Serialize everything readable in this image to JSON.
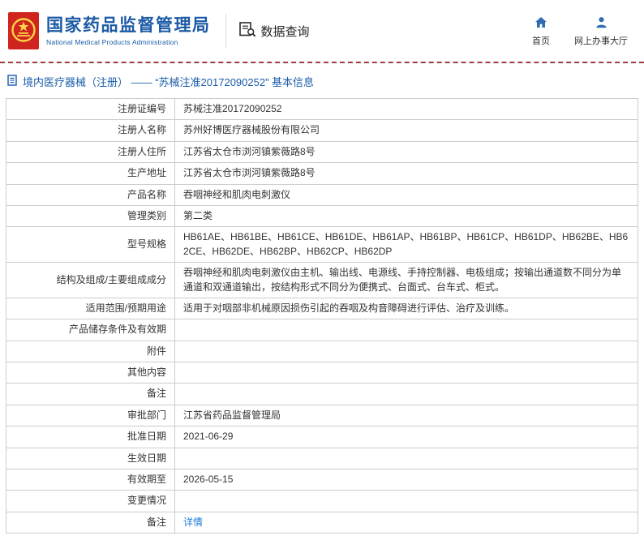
{
  "header": {
    "org_name_cn": "国家药品监督管理局",
    "org_name_en": "National Medical Products Administration",
    "data_query_label": "数据查询",
    "home_label": "首页",
    "service_hall_label": "网上办事大厅"
  },
  "breadcrumb": {
    "text": "境内医疗器械（注册） —— “苏械注准20172090252” 基本信息"
  },
  "detail_table": {
    "rows": [
      {
        "label": "注册证编号",
        "value": "苏械注准20172090252"
      },
      {
        "label": "注册人名称",
        "value": "苏州好博医疗器械股份有限公司"
      },
      {
        "label": "注册人住所",
        "value": "江苏省太仓市浏河镇紫薇路8号"
      },
      {
        "label": "生产地址",
        "value": "江苏省太仓市浏河镇紫薇路8号"
      },
      {
        "label": "产品名称",
        "value": "吞咽神经和肌肉电刺激仪"
      },
      {
        "label": "管理类别",
        "value": "第二类"
      },
      {
        "label": "型号规格",
        "value": "HB61AE、HB61BE、HB61CE、HB61DE、HB61AP、HB61BP、HB61CP、HB61DP、HB62BE、HB62CE、HB62DE、HB62BP、HB62CP、HB62DP"
      },
      {
        "label": "结构及组成/主要组成成分",
        "value": "吞咽神经和肌肉电刺激仪由主机、输出线、电源线、手持控制器、电极组成；按输出通道数不同分为单通道和双通道输出，按结构形式不同分为便携式、台面式、台车式、柜式。"
      },
      {
        "label": "适用范围/预期用途",
        "value": "适用于对咽部非机械原因损伤引起的吞咽及构音障碍进行评估、治疗及训练。"
      },
      {
        "label": "产品储存条件及有效期",
        "value": ""
      },
      {
        "label": "附件",
        "value": ""
      },
      {
        "label": "其他内容",
        "value": ""
      },
      {
        "label": "备注",
        "value": ""
      },
      {
        "label": "审批部门",
        "value": "江苏省药品监督管理局"
      },
      {
        "label": "批准日期",
        "value": "2021-06-29"
      },
      {
        "label": "生效日期",
        "value": ""
      },
      {
        "label": "有效期至",
        "value": "2026-05-15"
      },
      {
        "label": "变更情况",
        "value": ""
      },
      {
        "label": "备注",
        "value": "详情",
        "link": true
      }
    ]
  },
  "icons": {
    "logo": "national-emblem-logo",
    "data_query": "document-search-icon",
    "home": "home-icon",
    "service_hall": "user-icon",
    "breadcrumb": "document-icon"
  },
  "colors": {
    "brand_blue": "#1b5aa5",
    "emblem_red": "#d0241f",
    "emblem_yellow": "#f9d548",
    "icon_blue": "#2e6db4",
    "link_blue": "#1d7ad9",
    "divider_red": "#a23b3b",
    "table_border": "#cccccc"
  }
}
